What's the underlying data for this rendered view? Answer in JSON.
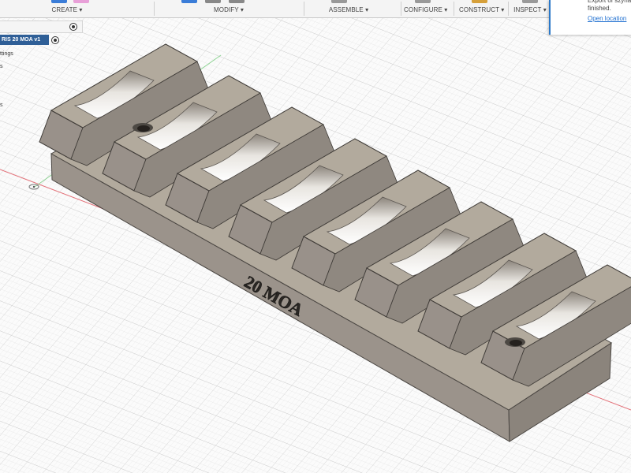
{
  "toolbar": {
    "groups": [
      {
        "label": "CREATE ▾"
      },
      {
        "label": "MODIFY ▾"
      },
      {
        "label": "ASSEMBLE ▾"
      },
      {
        "label": "CONFIGURE ▾"
      },
      {
        "label": "CONSTRUCT ▾"
      },
      {
        "label": "INSPECT ▾"
      }
    ]
  },
  "browser": {
    "document_name": "RIS 20 MOA v1",
    "items": [
      "ttings",
      "s",
      "s"
    ]
  },
  "notification": {
    "message": "Export of szyna\nfinished.",
    "link": "Open location"
  },
  "model": {
    "engraving": "20 MOA",
    "body_color": "#b2aa9d",
    "shadow_color": "#99918a"
  },
  "colors": {
    "accent": "#2f5f97",
    "link": "#1f6fd0",
    "axis_red": "#e0505a",
    "axis_green": "#62c46a"
  },
  "icons": {
    "cursor": "move-cursor-icon"
  }
}
